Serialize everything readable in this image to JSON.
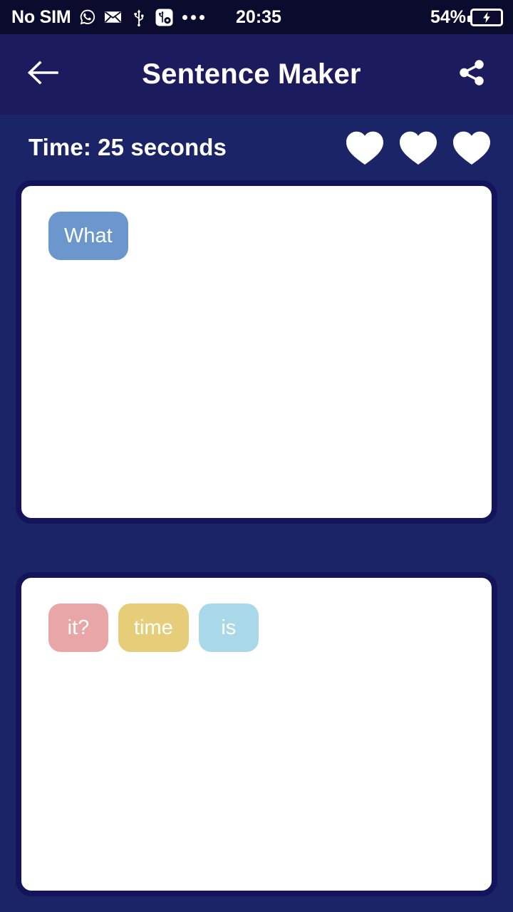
{
  "status_bar": {
    "sim_text": "No SIM",
    "icons": [
      "whatsapp-icon",
      "mail-icon",
      "usb-icon",
      "usb-debug-icon",
      "overflow-dots-icon"
    ],
    "clock": "20:35",
    "battery_percent": "54%",
    "battery_state": "charging"
  },
  "app_bar": {
    "back_label": "back-arrow",
    "title": "Sentence Maker",
    "share_label": "share"
  },
  "game": {
    "timer_text": "Time: 25 seconds",
    "lives": 3,
    "answer_chips": [
      {
        "text": "What",
        "color": "#6c97cd"
      }
    ],
    "bank_chips": [
      {
        "text": "it?",
        "color": "#e9a6a6"
      },
      {
        "text": "time",
        "color": "#e5cd79"
      },
      {
        "text": "is",
        "color": "#a9d9e9"
      }
    ]
  },
  "colors": {
    "status_bar_bg": "#0b0b2e",
    "app_bar_bg": "#1b1b5e",
    "page_bg": "#1c2468",
    "card_border": "#14145a",
    "card_bg": "#ffffff",
    "text_on_dark": "#ffffff"
  }
}
